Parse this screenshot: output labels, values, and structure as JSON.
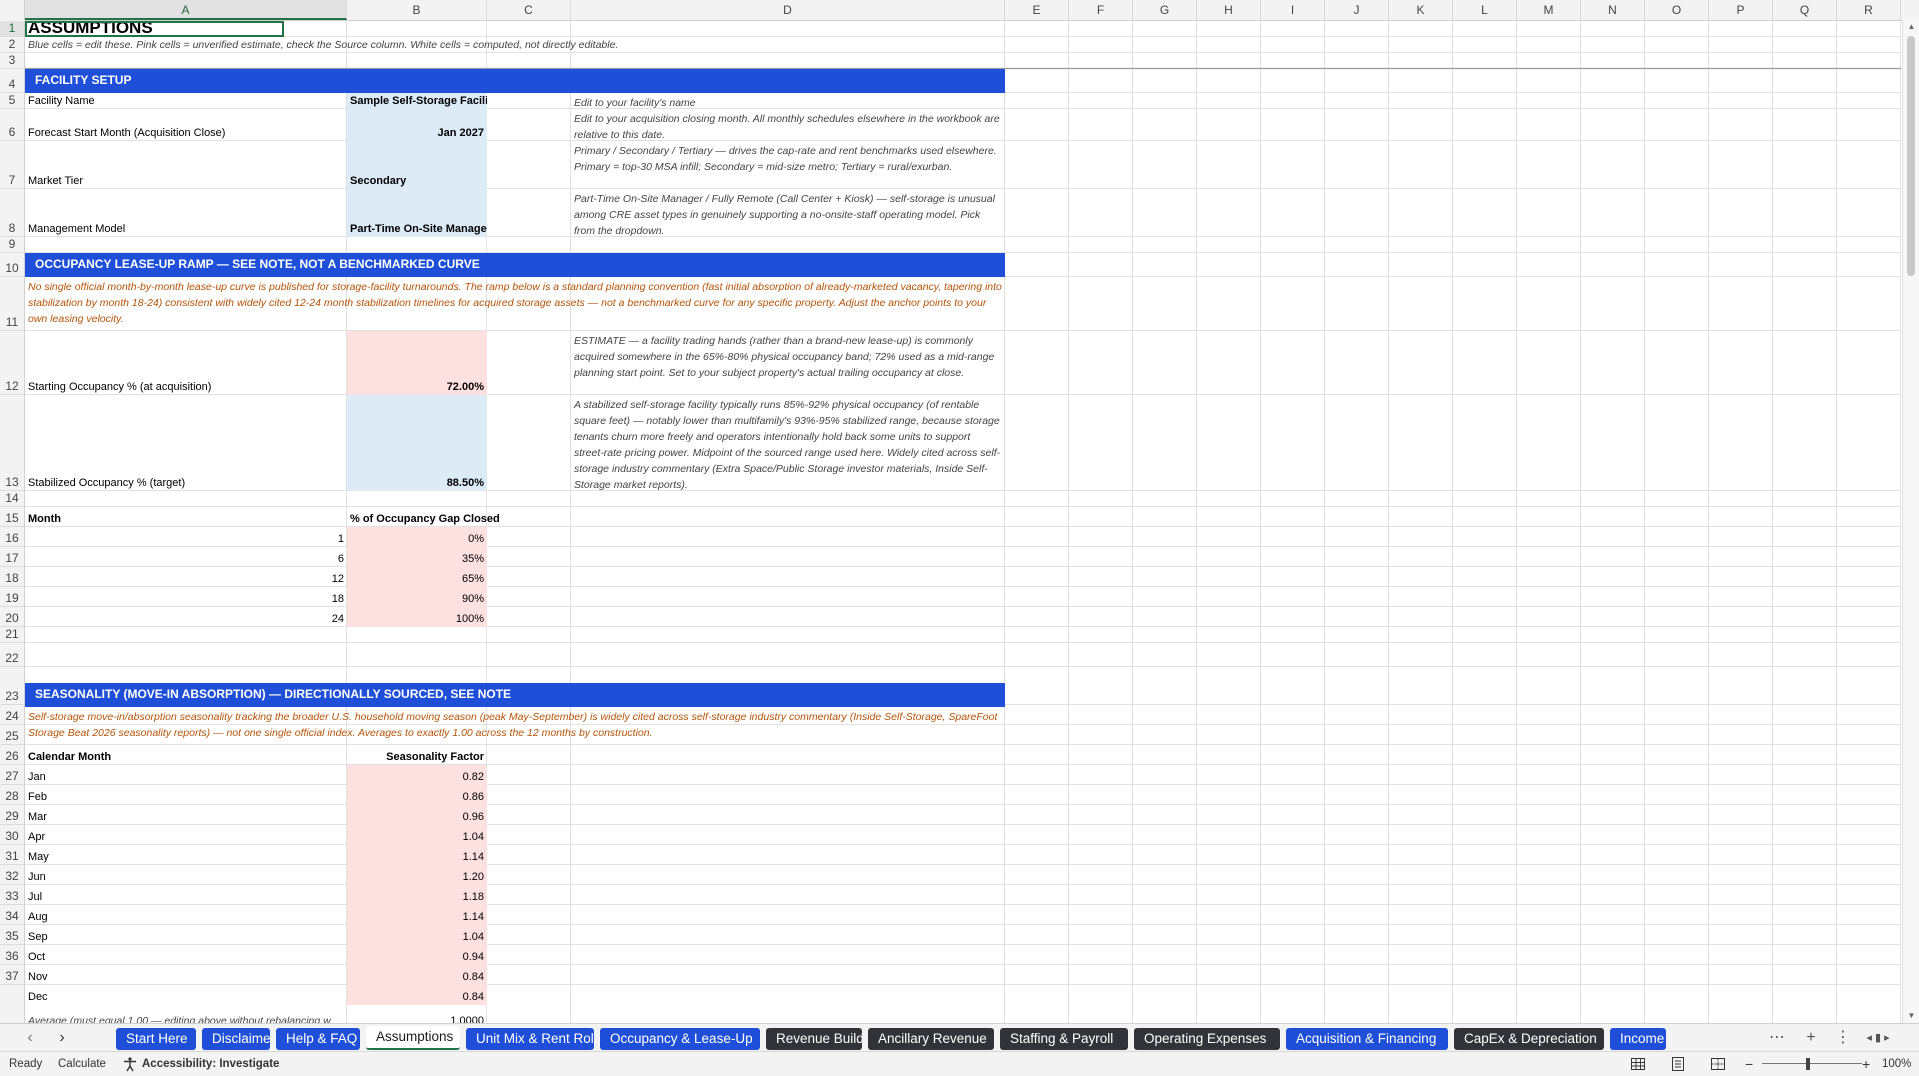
{
  "columns": [
    "A",
    "B",
    "C",
    "D",
    "E",
    "F",
    "G",
    "H",
    "I",
    "J",
    "K",
    "L",
    "M",
    "N",
    "O",
    "P",
    "Q",
    "R"
  ],
  "rows": [
    1,
    2,
    3,
    4,
    5,
    6,
    7,
    8,
    9,
    10,
    11,
    12,
    13,
    14,
    15,
    16,
    17,
    18,
    19,
    20,
    21,
    22,
    23,
    24,
    25,
    26,
    27,
    28,
    29,
    30,
    31,
    32,
    33,
    34,
    35,
    36,
    37
  ],
  "sheet": {
    "title": "ASSUMPTIONS",
    "subtitle": "Blue cells = edit these. Pink cells = unverified estimate, check the Source column. White cells = computed, not directly editable.",
    "facility_header": "FACILITY SETUP",
    "facility": [
      {
        "label": "Facility Name",
        "value": "Sample Self-Storage Facility",
        "note": "Edit to your facility's name"
      },
      {
        "label": "Forecast Start Month (Acquisition Close)",
        "value": "Jan 2027",
        "note": "Edit to your acquisition closing month. All monthly schedules elsewhere in the workbook are relative to this date."
      },
      {
        "label": "Market Tier",
        "value": "Secondary",
        "note": "Primary / Secondary / Tertiary — drives the cap-rate and rent benchmarks used elsewhere. Primary = top-30 MSA infill; Secondary = mid-size metro; Tertiary = rural/exurban."
      },
      {
        "label": "Management Model",
        "value": "Part-Time On-Site Manager",
        "note": "Part-Time On-Site Manager / Fully Remote (Call Center + Kiosk) — self-storage is unusual among CRE asset types in genuinely supporting a no-onsite-staff operating model. Pick from the dropdown."
      }
    ],
    "occupancy_header": "OCCUPANCY LEASE-UP RAMP  —  SEE NOTE, NOT A BENCHMARKED CURVE",
    "occupancy_note": "No single official month-by-month lease-up curve is published for storage-facility turnarounds. The ramp below is a standard planning convention (fast initial absorption of already-marketed vacancy, tapering into stabilization by month 18-24) consistent with widely cited 12-24 month stabilization timelines for acquired storage assets — not a benchmarked curve for any specific property. Adjust the anchor points to your own leasing velocity.",
    "starting_occ": {
      "label": "Starting Occupancy % (at acquisition)",
      "value": "72.00%",
      "note": "ESTIMATE — a facility trading hands (rather than a brand-new lease-up) is commonly acquired somewhere in the 65%-80% physical occupancy band; 72% used as a mid-range planning start point. Set to your subject property's actual trailing occupancy at close."
    },
    "stabilized_occ": {
      "label": "Stabilized Occupancy % (target)",
      "value": "88.50%",
      "note": "A stabilized self-storage facility typically runs 85%-92% physical occupancy (of rentable square feet) — notably lower than multifamily's 93%-95% stabilized range, because storage tenants churn more freely and operators intentionally hold back some units to support street-rate pricing power. Midpoint of the sourced range used here. Widely cited across self-storage industry commentary (Extra Space/Public Storage investor materials, Inside Self-Storage market reports)."
    },
    "ramp_headers": {
      "month": "Month",
      "gap": "% of Occupancy Gap Closed"
    },
    "ramp": [
      {
        "month": "1",
        "gap": "0%"
      },
      {
        "month": "6",
        "gap": "35%"
      },
      {
        "month": "12",
        "gap": "65%"
      },
      {
        "month": "18",
        "gap": "90%"
      },
      {
        "month": "24",
        "gap": "100%"
      }
    ],
    "season_header": "SEASONALITY (MOVE-IN ABSORPTION)  —  DIRECTIONALLY SOURCED, SEE NOTE",
    "season_note": "Self-storage move-in/absorption seasonality tracking the broader U.S. household moving season (peak May-September) is widely cited across self-storage industry commentary (Inside Self-Storage, SpareFoot Storage Beat 2026 seasonality reports) — not one single official index. Averages to exactly 1.00 across the 12 months by construction.",
    "season_headers": {
      "month": "Calendar Month",
      "factor": "Seasonality Factor"
    },
    "season": [
      {
        "month": "Jan",
        "factor": "0.82"
      },
      {
        "month": "Feb",
        "factor": "0.86"
      },
      {
        "month": "Mar",
        "factor": "0.96"
      },
      {
        "month": "Apr",
        "factor": "1.04"
      },
      {
        "month": "May",
        "factor": "1.14"
      },
      {
        "month": "Jun",
        "factor": "1.20"
      },
      {
        "month": "Jul",
        "factor": "1.18"
      },
      {
        "month": "Aug",
        "factor": "1.14"
      },
      {
        "month": "Sep",
        "factor": "1.04"
      },
      {
        "month": "Oct",
        "factor": "0.94"
      },
      {
        "month": "Nov",
        "factor": "0.84"
      },
      {
        "month": "Dec",
        "factor": "0.84"
      }
    ],
    "average_label": "Average (must equal 1.00 — editing above without rebalancing w",
    "average_value": "1.0000"
  },
  "tabs": [
    {
      "label": "Start Here",
      "style": "blue"
    },
    {
      "label": "Disclaimer",
      "style": "blue"
    },
    {
      "label": "Help & FAQ",
      "style": "blue"
    },
    {
      "label": "Assumptions",
      "style": "active"
    },
    {
      "label": "Unit Mix & Rent Roll",
      "style": "blue"
    },
    {
      "label": "Occupancy & Lease-Up",
      "style": "blue"
    },
    {
      "label": "Revenue Build",
      "style": "dark"
    },
    {
      "label": "Ancillary Revenue",
      "style": "dark"
    },
    {
      "label": "Staffing & Payroll",
      "style": "dark"
    },
    {
      "label": "Operating Expenses",
      "style": "dark"
    },
    {
      "label": "Acquisition & Financing",
      "style": "blue"
    },
    {
      "label": "CapEx & Depreciation",
      "style": "dark"
    },
    {
      "label": "Income",
      "style": "blue"
    }
  ],
  "status": {
    "ready": "Ready",
    "calculate": "Calculate",
    "accessibility": "Accessibility: Investigate",
    "zoom": "100%"
  },
  "colors": {
    "header_band": "#1f4fd8",
    "input_blue": "#ddebf7",
    "estimate_pink": "#fde0e0",
    "note_orange": "#b45309",
    "tab_dark": "#303338"
  },
  "icons": [
    "chevron-left-icon",
    "chevron-right-icon",
    "more-icon",
    "add-sheet-icon",
    "options-icon",
    "normal-view-icon",
    "page-layout-icon",
    "page-break-icon",
    "accessibility-icon"
  ]
}
